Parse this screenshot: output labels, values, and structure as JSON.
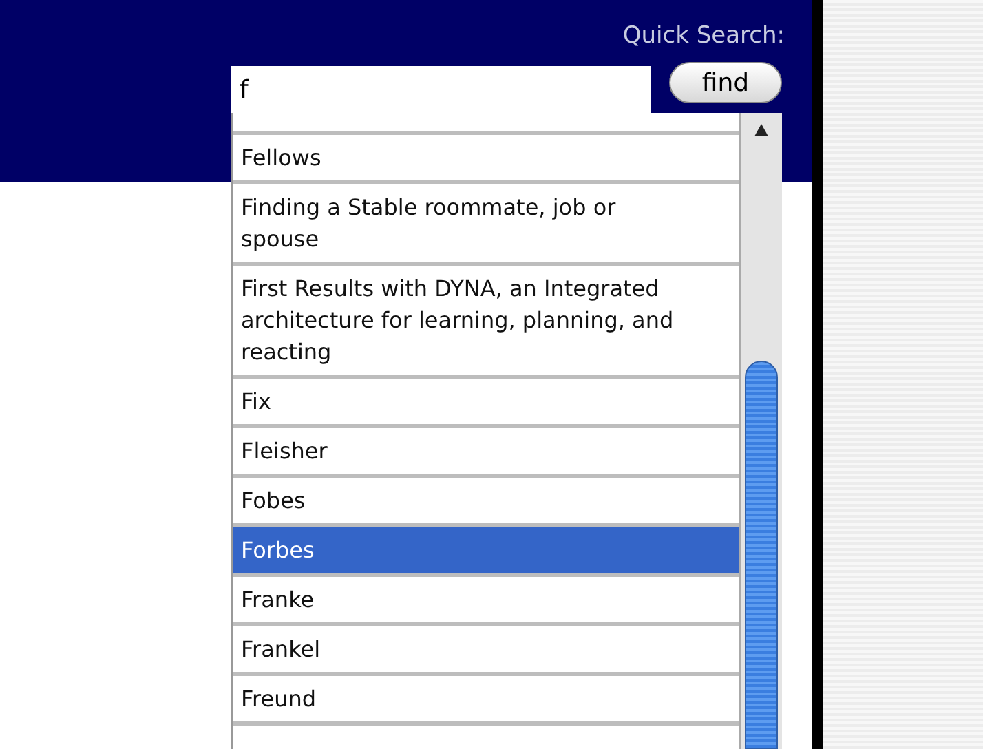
{
  "quick_search": {
    "label": "Quick Search:",
    "query": "f",
    "button": "find"
  },
  "results": [
    {
      "label": "Fellows",
      "selected": false
    },
    {
      "label": "Finding a Stable roommate, job or spouse",
      "selected": false
    },
    {
      "label": "First Results with DYNA, an Integrated architecture for learning, planning, and reacting",
      "selected": false
    },
    {
      "label": "Fix",
      "selected": false
    },
    {
      "label": "Fleisher",
      "selected": false
    },
    {
      "label": "Fobes",
      "selected": false
    },
    {
      "label": "Forbes",
      "selected": true
    },
    {
      "label": "Franke",
      "selected": false
    },
    {
      "label": "Frankel",
      "selected": false
    },
    {
      "label": "Freund",
      "selected": false
    }
  ]
}
